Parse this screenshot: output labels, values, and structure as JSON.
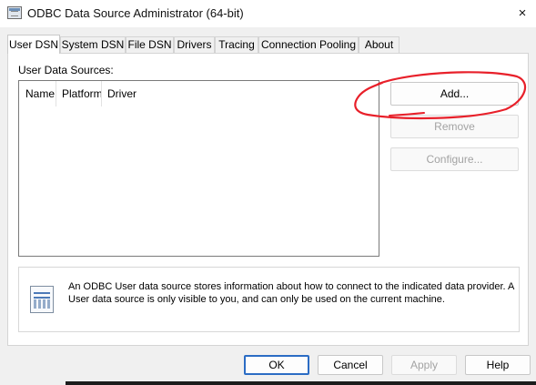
{
  "window": {
    "title": "ODBC Data Source Administrator (64-bit)",
    "close_icon": "×"
  },
  "tabs": [
    {
      "label": "User DSN",
      "active": true
    },
    {
      "label": "System DSN",
      "active": false
    },
    {
      "label": "File DSN",
      "active": false
    },
    {
      "label": "Drivers",
      "active": false
    },
    {
      "label": "Tracing",
      "active": false
    },
    {
      "label": "Connection Pooling",
      "active": false
    },
    {
      "label": "About",
      "active": false
    }
  ],
  "user_dsn": {
    "sources_label": "User Data Sources:",
    "columns": [
      "Name",
      "Platform",
      "Driver"
    ],
    "rows": [],
    "buttons": {
      "add": "Add...",
      "remove": "Remove",
      "configure": "Configure..."
    },
    "info_text": "An ODBC User data source stores information about how to connect to the indicated data provider.  A User data source is only visible to you, and can only be used on the current machine."
  },
  "footer": {
    "ok": "OK",
    "cancel": "Cancel",
    "apply": "Apply",
    "help": "Help"
  },
  "colors": {
    "annotation": "#e8202a",
    "default_button_border": "#2b6cc4",
    "disabled_text": "#a3a3a3"
  },
  "icons": {
    "window": "odbc-app-icon",
    "info": "data-sources-document-icon"
  }
}
